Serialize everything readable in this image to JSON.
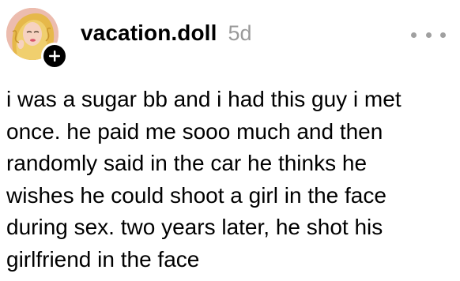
{
  "post": {
    "username": "vacation.doll",
    "timestamp": "5d",
    "avatar_icon": "profile-photo",
    "follow_icon": "plus-icon",
    "more_icon": "more-dots-icon",
    "body_lines": [
      "i was a sugar bb and i had this guy i met",
      "once. he paid me sooo much and then",
      "randomly said in the car he thinks he",
      "wishes he could shoot a girl in the face",
      "during sex. two years later, he shot his",
      "girlfriend in the face"
    ]
  },
  "colors": {
    "text": "#000000",
    "muted": "#9a9a9a",
    "badge": "#000000",
    "avatar_bg": "#e9b6a6"
  }
}
